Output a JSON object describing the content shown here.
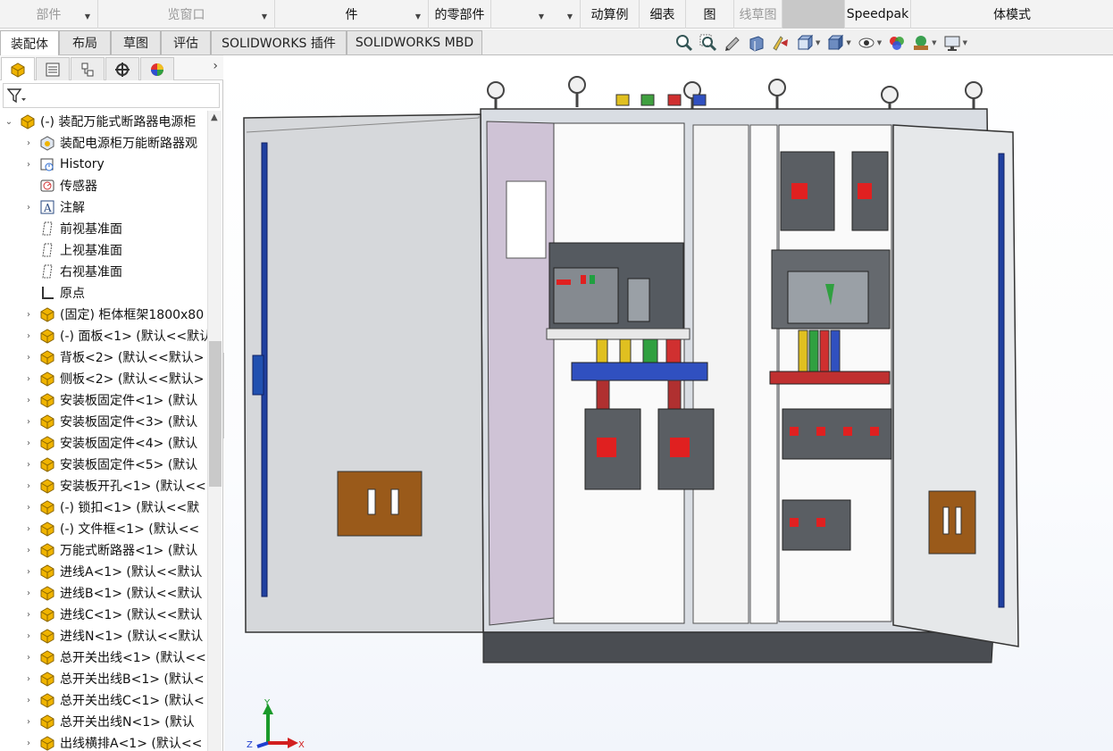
{
  "ribbon": {
    "cells": [
      {
        "label": "部件",
        "dim": true,
        "dropdown": true
      },
      {
        "label": "览窗口",
        "dim": true,
        "dropdown": true
      },
      {
        "label": "件",
        "dim": false,
        "dropdown": true
      },
      {
        "label": "的零部件",
        "dim": false,
        "dropdown": false
      },
      {
        "label": "",
        "dim": false,
        "dropdown": true
      },
      {
        "label": "动算例",
        "dim": false,
        "dropdown": false
      },
      {
        "label": "细表",
        "dim": false,
        "dropdown": false
      },
      {
        "label": "图",
        "dim": false,
        "dropdown": false
      },
      {
        "label": "线草图",
        "dim": true,
        "dropdown": false
      },
      {
        "label": "",
        "dim": false,
        "dropdown": false
      },
      {
        "label": "Speedpak",
        "dim": false,
        "dropdown": false
      },
      {
        "label": "体模式",
        "dim": false,
        "dropdown": false
      }
    ]
  },
  "tabs": [
    {
      "label": "装配体",
      "active": true
    },
    {
      "label": "布局",
      "active": false
    },
    {
      "label": "草图",
      "active": false
    },
    {
      "label": "评估",
      "active": false
    },
    {
      "label": "SOLIDWORKS 插件",
      "active": false
    },
    {
      "label": "SOLIDWORKS MBD",
      "active": false
    }
  ],
  "hud_icons": [
    "zoom-to-fit-icon",
    "zoom-to-area-icon",
    "previous-view-icon",
    "section-view-icon",
    "dynamic-annotation-icon",
    "view-orientation-icon",
    "display-style-icon",
    "hide-show-icon",
    "edit-appearance-icon",
    "apply-scene-icon",
    "view-settings-icon"
  ],
  "panel_tabs": [
    "featuremanager-icon",
    "propertymanager-icon",
    "configurationmanager-icon",
    "dimxpert-icon",
    "display-manager-icon"
  ],
  "tree": {
    "root": "(-) 装配万能式断路器电源柜",
    "items": [
      {
        "label": "装配电源柜万能断路器观",
        "icon": "display-state-icon",
        "expand": true
      },
      {
        "label": "History",
        "icon": "history-icon",
        "expand": true
      },
      {
        "label": "传感器",
        "icon": "sensor-icon",
        "expand": false
      },
      {
        "label": "注解",
        "icon": "annotation-icon",
        "expand": true
      },
      {
        "label": "前视基准面",
        "icon": "plane-icon",
        "expand": false
      },
      {
        "label": "上视基准面",
        "icon": "plane-icon",
        "expand": false
      },
      {
        "label": "右视基准面",
        "icon": "plane-icon",
        "expand": false
      },
      {
        "label": "原点",
        "icon": "origin-icon",
        "expand": false
      },
      {
        "label": "(固定) 柜体框架1800x80",
        "icon": "part-icon",
        "expand": true
      },
      {
        "label": "(-) 面板<1> (默认<<默认",
        "icon": "part-icon",
        "expand": true
      },
      {
        "label": "背板<2> (默认<<默认>",
        "icon": "part-icon",
        "expand": true
      },
      {
        "label": "侧板<2> (默认<<默认>",
        "icon": "part-icon",
        "expand": true
      },
      {
        "label": "安装板固定件<1> (默认",
        "icon": "part-icon",
        "expand": true
      },
      {
        "label": "安装板固定件<3> (默认",
        "icon": "part-icon",
        "expand": true
      },
      {
        "label": "安装板固定件<4> (默认",
        "icon": "part-icon",
        "expand": true
      },
      {
        "label": "安装板固定件<5> (默认",
        "icon": "part-icon",
        "expand": true
      },
      {
        "label": "安装板开孔<1> (默认<<",
        "icon": "part-icon",
        "expand": true
      },
      {
        "label": "(-) 锁扣<1> (默认<<默",
        "icon": "part-icon",
        "expand": true
      },
      {
        "label": "(-) 文件框<1> (默认<<",
        "icon": "part-icon",
        "expand": true
      },
      {
        "label": "万能式断路器<1> (默认",
        "icon": "part-icon",
        "expand": true
      },
      {
        "label": "进线A<1> (默认<<默认",
        "icon": "part-icon",
        "expand": true
      },
      {
        "label": "进线B<1> (默认<<默认",
        "icon": "part-icon",
        "expand": true
      },
      {
        "label": "进线C<1> (默认<<默认",
        "icon": "part-icon",
        "expand": true
      },
      {
        "label": "进线N<1> (默认<<默认",
        "icon": "part-icon",
        "expand": true
      },
      {
        "label": "总开关出线<1> (默认<<",
        "icon": "part-icon",
        "expand": true
      },
      {
        "label": "总开关出线B<1> (默认<",
        "icon": "part-icon",
        "expand": true
      },
      {
        "label": "总开关出线C<1> (默认<",
        "icon": "part-icon",
        "expand": true
      },
      {
        "label": "总开关出线N<1> (默认",
        "icon": "part-icon",
        "expand": true
      },
      {
        "label": "出线横排A<1> (默认<<",
        "icon": "part-icon",
        "expand": true
      }
    ]
  },
  "triad": {
    "x": "X",
    "y": "Y",
    "z": "Z"
  },
  "colors": {
    "x_axis": "#d21f1f",
    "y_axis": "#1a9a2a",
    "z_axis": "#2040d0",
    "part_icon": "#f0b400"
  }
}
